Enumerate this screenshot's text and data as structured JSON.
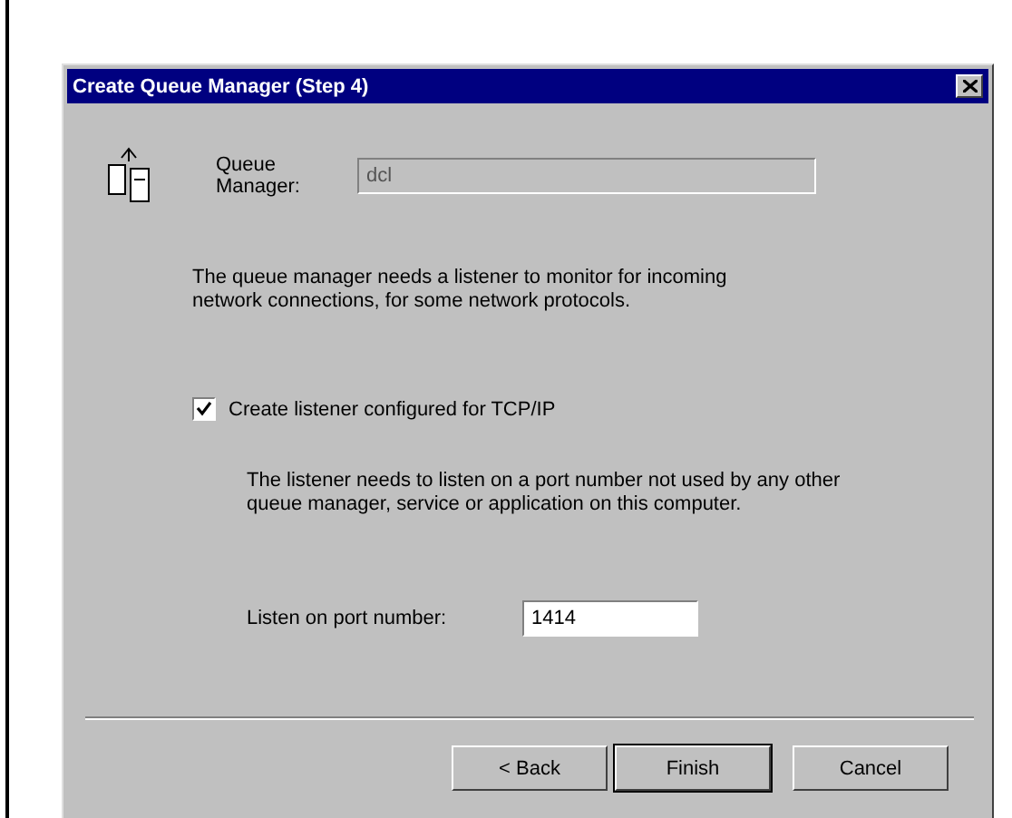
{
  "window": {
    "title": "Create Queue Manager (Step 4)"
  },
  "queue_manager": {
    "label": "Queue Manager:",
    "value": "dcl",
    "disabled": true
  },
  "intro": "The queue manager needs a listener to monitor for incoming network connections, for some network protocols.",
  "listener_checkbox": {
    "label": "Create listener configured for TCP/IP",
    "checked": true
  },
  "note": "The listener needs to listen on a port number not used by any other queue manager, service or application on this computer.",
  "port": {
    "label": "Listen on port number:",
    "value": "1414"
  },
  "buttons": [
    {
      "label": "< Back",
      "default": false
    },
    {
      "label": "Finish",
      "default": true
    },
    {
      "label": "Cancel",
      "default": false
    }
  ]
}
